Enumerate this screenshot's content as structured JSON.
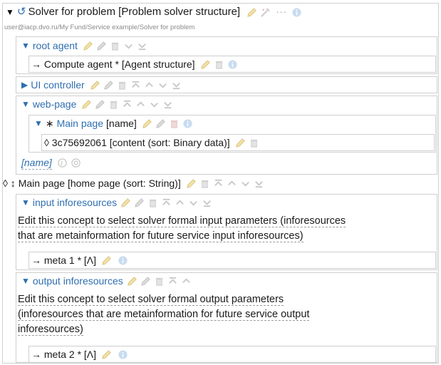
{
  "solver": {
    "refresh_symbol": "↺",
    "title": "Solver for problem [Problem solver structure]",
    "path": "user@iacp.dvo.ru/My Fund/Service example/Solver for problem",
    "ellipsis": "···"
  },
  "root_agent": {
    "label": "root agent",
    "child": "→ Compute agent * [Agent structure]"
  },
  "ui_controller": {
    "label": "UI controller"
  },
  "web_page": {
    "label": "web-page",
    "main_page_star": "∗",
    "main_page_label": "Main page",
    "main_page_suffix": "[name]",
    "content": "◊ 3c75692061 [content (sort: Binary data)]",
    "name_label": "[name]"
  },
  "home_page": {
    "label": "◊ ↕ Main page [home page (sort: String)]"
  },
  "input_inforesources": {
    "label": "input inforesources",
    "description_line1": "Edit this concept to select solver formal input parameters (inforesources",
    "description_line2": "that are metainformation for future service input inforesources)",
    "meta": "→ meta 1 * [Λ]"
  },
  "output_inforesources": {
    "label": "output inforesources",
    "description_line1": "Edit this concept to select solver formal output parameters",
    "description_line2": "(inforesources that are metainformation for future service output",
    "description_line3": "inforesources)",
    "meta": "→ meta 2 * [Λ]"
  },
  "icons": {
    "expanded": "▼",
    "collapsed": "▶"
  },
  "colors": {
    "accent_blue": "#2f6fb0",
    "icon_grey": "#c8c8c8",
    "icon_yellow": "#f0d890",
    "border": "#cfcfcf"
  }
}
